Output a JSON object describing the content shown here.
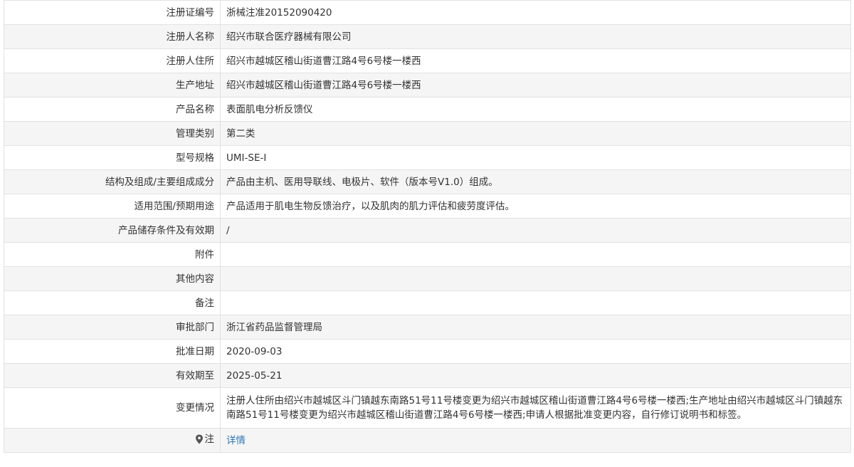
{
  "rows": [
    {
      "label": "注册证编号",
      "value": "浙械注准20152090420"
    },
    {
      "label": "注册人名称",
      "value": "绍兴市联合医疗器械有限公司"
    },
    {
      "label": "注册人住所",
      "value": "绍兴市越城区稽山街道曹江路4号6号楼一楼西"
    },
    {
      "label": "生产地址",
      "value": "绍兴市越城区稽山街道曹江路4号6号楼一楼西"
    },
    {
      "label": "产品名称",
      "value": "表面肌电分析反馈仪"
    },
    {
      "label": "管理类别",
      "value": "第二类"
    },
    {
      "label": "型号规格",
      "value": "UMI-SE-Ⅰ"
    },
    {
      "label": "结构及组成/主要组成成分",
      "value": "产品由主机、医用导联线、电极片、软件（版本号V1.0）组成。"
    },
    {
      "label": "适用范围/预期用途",
      "value": "产品适用于肌电生物反馈治疗，以及肌肉的肌力评估和疲劳度评估。"
    },
    {
      "label": "产品储存条件及有效期",
      "value": "/"
    },
    {
      "label": "附件",
      "value": ""
    },
    {
      "label": "其他内容",
      "value": ""
    },
    {
      "label": "备注",
      "value": ""
    },
    {
      "label": "审批部门",
      "value": "浙江省药品监督管理局"
    },
    {
      "label": "批准日期",
      "value": "2020-09-03"
    },
    {
      "label": "有效期至",
      "value": "2025-05-21"
    },
    {
      "label": "变更情况",
      "value": "注册人住所由绍兴市越城区斗门镇越东南路51号11号楼变更为绍兴市越城区稽山街道曹江路4号6号楼一楼西;生产地址由绍兴市越城区斗门镇越东南路51号11号楼变更为绍兴市越城区稽山街道曹江路4号6号楼一楼西;申请人根据批准变更内容，自行修订说明书和标签。"
    }
  ],
  "note": {
    "label": "注",
    "link_text": "详情",
    "icon": "map-pin-icon"
  }
}
